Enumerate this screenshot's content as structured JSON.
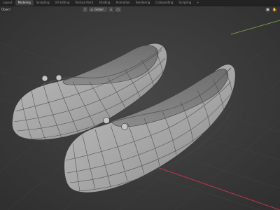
{
  "app": {
    "workspaces": [
      "Layout",
      "Modeling",
      "Sculpting",
      "UV Editing",
      "Texture Paint",
      "Shading",
      "Animation",
      "Rendering",
      "Compositing",
      "Scripting",
      "+"
    ],
    "active_workspace": "Modeling"
  },
  "viewport_header": {
    "mode_label": "Object",
    "transform_orientation": "Global"
  },
  "colors": {
    "background": "#3a3a3a",
    "mesh": "#a7a7a7",
    "wire": "#4a4a4a",
    "x_axis": "#c4344b",
    "y_axis": "#7fb23f"
  },
  "icons": {
    "camera": "camera-icon",
    "pan": "hand-icon",
    "snap": "magnet-icon",
    "proportional": "proportional-editing-icon",
    "pivot": "pivot-icon"
  }
}
